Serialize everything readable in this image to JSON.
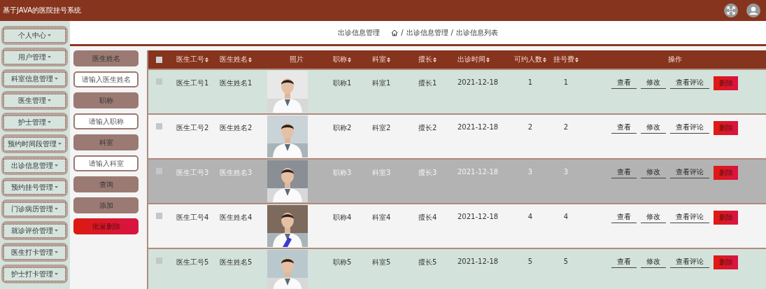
{
  "app_title": "基于JAVA的医院挂号系统",
  "sidebar": {
    "items": [
      {
        "label": "个人中心"
      },
      {
        "label": "用户管理"
      },
      {
        "label": "科室信息管理"
      },
      {
        "label": "医生管理"
      },
      {
        "label": "护士管理"
      },
      {
        "label": "预约时间段管理"
      },
      {
        "label": "出诊信息管理"
      },
      {
        "label": "预约挂号管理"
      },
      {
        "label": "门诊病历管理"
      },
      {
        "label": "就诊评价管理"
      },
      {
        "label": "医生打卡管理"
      },
      {
        "label": "护士打卡管理"
      }
    ]
  },
  "breadcrumb": {
    "page_title": "出诊信息管理",
    "separator": "/",
    "trail": [
      "出诊信息管理",
      "出诊信息列表"
    ]
  },
  "search": {
    "fields": [
      {
        "label": "医生姓名",
        "placeholder": "请输入医生姓名"
      },
      {
        "label": "职称",
        "placeholder": "请输入职称"
      },
      {
        "label": "科室",
        "placeholder": "请输入科室"
      }
    ],
    "buttons": [
      {
        "label": "查询",
        "kind": "default"
      },
      {
        "label": "添加",
        "kind": "default"
      },
      {
        "label": "批量删除",
        "kind": "danger"
      }
    ]
  },
  "table": {
    "all_checked": false,
    "columns": [
      {
        "label": "医生工号",
        "sortable": true
      },
      {
        "label": "医生姓名",
        "sortable": true
      },
      {
        "label": "照片",
        "sortable": false
      },
      {
        "label": "职称",
        "sortable": true
      },
      {
        "label": "科室",
        "sortable": true
      },
      {
        "label": "擅长",
        "sortable": true
      },
      {
        "label": "出诊时间",
        "sortable": true
      },
      {
        "label": "可约人数",
        "sortable": true
      },
      {
        "label": "挂号费",
        "sortable": true
      },
      {
        "label": "操作",
        "sortable": false
      }
    ],
    "rows": [
      {
        "checked": false,
        "hovered": false,
        "cells": [
          "医生工号1",
          "医生姓名1",
          {
            "kind": "picture"
          },
          "职称1",
          "科室1",
          "擅长1",
          "2021-12-18",
          "1",
          "1"
        ],
        "actions": [
          {
            "label": "查看",
            "kind": "link"
          },
          {
            "label": "修改",
            "kind": "link"
          },
          {
            "label": "查看评论",
            "kind": "link"
          },
          {
            "label": "删除",
            "kind": "danger"
          }
        ]
      },
      {
        "checked": false,
        "hovered": false,
        "cells": [
          "医生工号2",
          "医生姓名2",
          {
            "kind": "picture"
          },
          "职称2",
          "科室2",
          "擅长2",
          "2021-12-18",
          "2",
          "2"
        ],
        "actions": [
          {
            "label": "查看",
            "kind": "link"
          },
          {
            "label": "修改",
            "kind": "link"
          },
          {
            "label": "查看评论",
            "kind": "link"
          },
          {
            "label": "删除",
            "kind": "danger"
          }
        ]
      },
      {
        "checked": false,
        "hovered": true,
        "cells": [
          "医生工号3",
          "医生姓名3",
          {
            "kind": "picture"
          },
          "职称3",
          "科室3",
          "擅长3",
          "2021-12-18",
          "3",
          "3"
        ],
        "actions": [
          {
            "label": "查看",
            "kind": "link"
          },
          {
            "label": "修改",
            "kind": "link"
          },
          {
            "label": "查看评论",
            "kind": "link"
          },
          {
            "label": "删除",
            "kind": "danger"
          }
        ]
      },
      {
        "checked": false,
        "hovered": false,
        "cells": [
          "医生工号4",
          "医生姓名4",
          {
            "kind": "picture"
          },
          "职称4",
          "科室4",
          "擅长4",
          "2021-12-18",
          "4",
          "4"
        ],
        "actions": [
          {
            "label": "查看",
            "kind": "link"
          },
          {
            "label": "修改",
            "kind": "link"
          },
          {
            "label": "查看评论",
            "kind": "link"
          },
          {
            "label": "删除",
            "kind": "danger"
          }
        ]
      },
      {
        "checked": false,
        "hovered": false,
        "cells": [
          "医生工号5",
          "医生姓名5",
          {
            "kind": "picture"
          },
          "职称5",
          "科室5",
          "擅长5",
          "2021-12-18",
          "5",
          "5"
        ],
        "actions": [
          {
            "label": "查看",
            "kind": "link"
          },
          {
            "label": "修改",
            "kind": "link"
          },
          {
            "label": "查看评论",
            "kind": "link"
          },
          {
            "label": "删除",
            "kind": "danger"
          }
        ]
      }
    ]
  }
}
